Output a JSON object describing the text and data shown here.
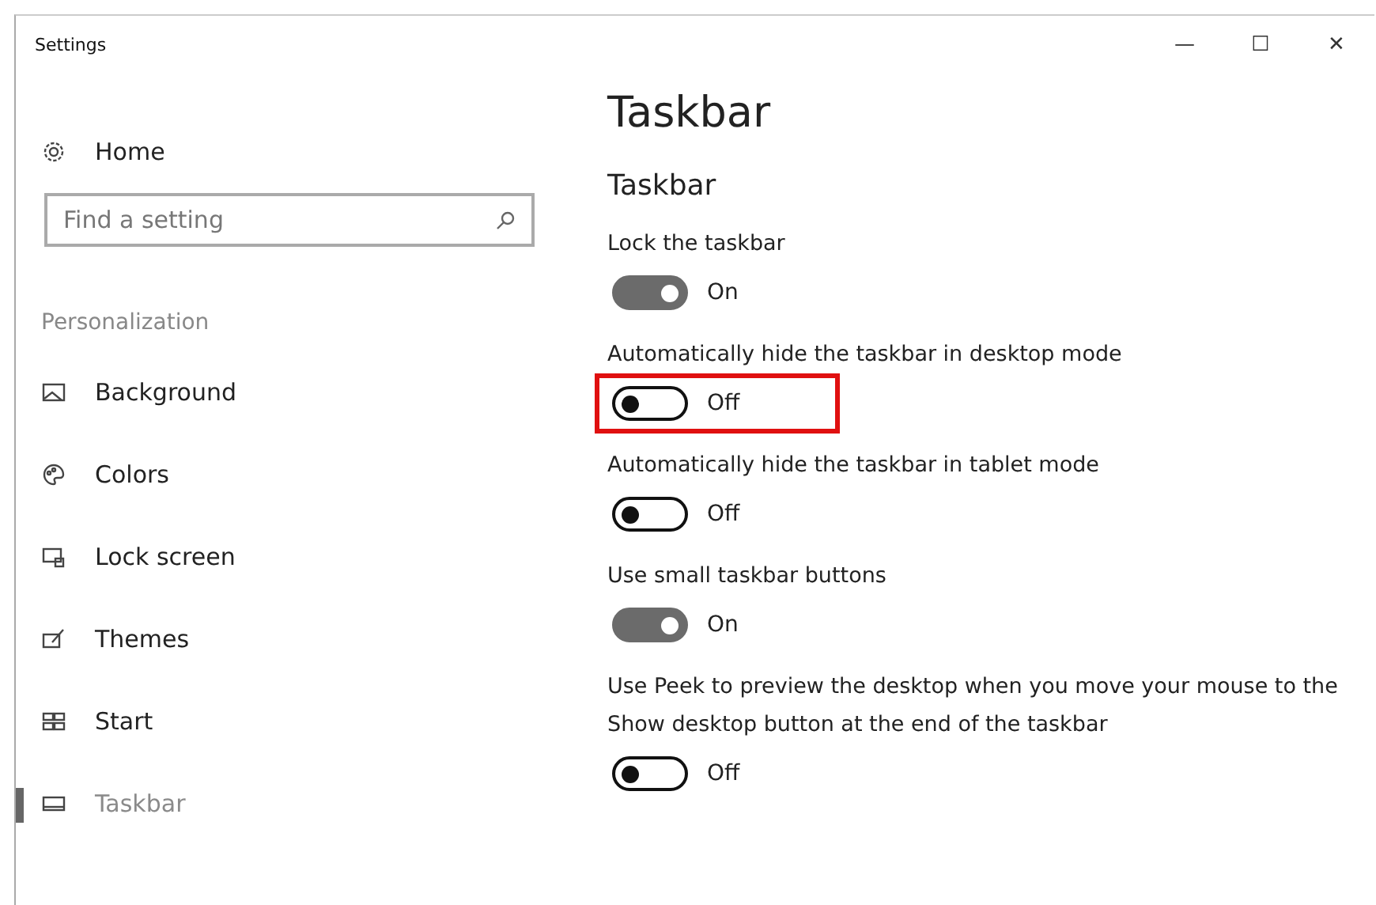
{
  "window": {
    "title": "Settings",
    "controls": [
      "—",
      "☐",
      "✕"
    ]
  },
  "sidebar": {
    "home": "Home",
    "search": {
      "placeholder": "Find a setting"
    },
    "section": "Personalization",
    "items": [
      {
        "label": "Background",
        "selected": false
      },
      {
        "label": "Colors",
        "selected": false
      },
      {
        "label": "Lock screen",
        "selected": false
      },
      {
        "label": "Themes",
        "selected": false
      },
      {
        "label": "Start",
        "selected": false
      },
      {
        "label": "Taskbar",
        "selected": true
      }
    ]
  },
  "content": {
    "title": "Taskbar",
    "subtitle": "Taskbar",
    "settings": [
      {
        "label": "Lock the taskbar",
        "on": true,
        "state": "On",
        "highlighted": false
      },
      {
        "label": "Automatically hide the taskbar in desktop mode",
        "on": false,
        "state": "Off",
        "highlighted": true
      },
      {
        "label": "Automatically hide the taskbar in tablet mode",
        "on": false,
        "state": "Off",
        "highlighted": false
      },
      {
        "label": "Use small taskbar buttons",
        "on": true,
        "state": "On",
        "highlighted": false
      },
      {
        "label": "Use Peek to preview the desktop when you move your mouse to the Show desktop button at the end of the taskbar",
        "on": false,
        "state": "Off",
        "highlighted": false
      }
    ]
  }
}
